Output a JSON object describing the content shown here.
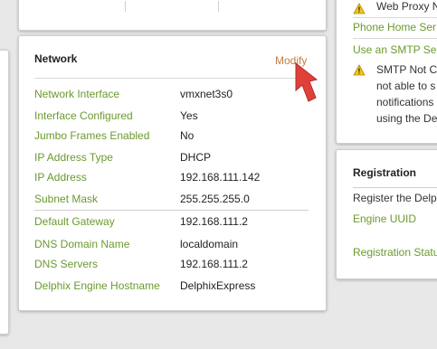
{
  "top_notice": {
    "web_proxy": "Web Proxy N",
    "phone_home": "Phone Home Ser",
    "smtp_link": "Use an SMTP Ser",
    "smtp_warning": [
      "SMTP Not C",
      "not able to s",
      "notifications",
      "using the De"
    ]
  },
  "network": {
    "title": "Network",
    "modify_label": "Modify",
    "rows": [
      {
        "label": "Network Interface",
        "value": "vmxnet3s0"
      },
      {
        "label": "Interface Configured",
        "value": "Yes"
      },
      {
        "label": "Jumbo Frames Enabled",
        "value": "No"
      },
      {
        "label": "IP Address Type",
        "value": "DHCP"
      },
      {
        "label": "IP Address",
        "value": "192.168.111.142"
      },
      {
        "label": "Subnet Mask",
        "value": "255.255.255.0"
      },
      {
        "label": "Default Gateway",
        "value": "192.168.111.2"
      },
      {
        "label": "DNS Domain Name",
        "value": "localdomain"
      },
      {
        "label": "DNS Servers",
        "value": "192.168.111.2"
      },
      {
        "label": "Delphix Engine Hostname",
        "value": "DelphixExpress"
      }
    ]
  },
  "registration": {
    "title": "Registration",
    "register_text": "Register the Delph",
    "engine_uuid": "Engine UUID",
    "registration_status": "Registration Statu"
  },
  "icons": {
    "warning": "warning-icon",
    "pointer": "red-arrow-pointer-icon"
  },
  "colors": {
    "label_green": "#6b9a2e",
    "modify_orange": "#c47d3e",
    "arrow_red": "#e0403a"
  }
}
